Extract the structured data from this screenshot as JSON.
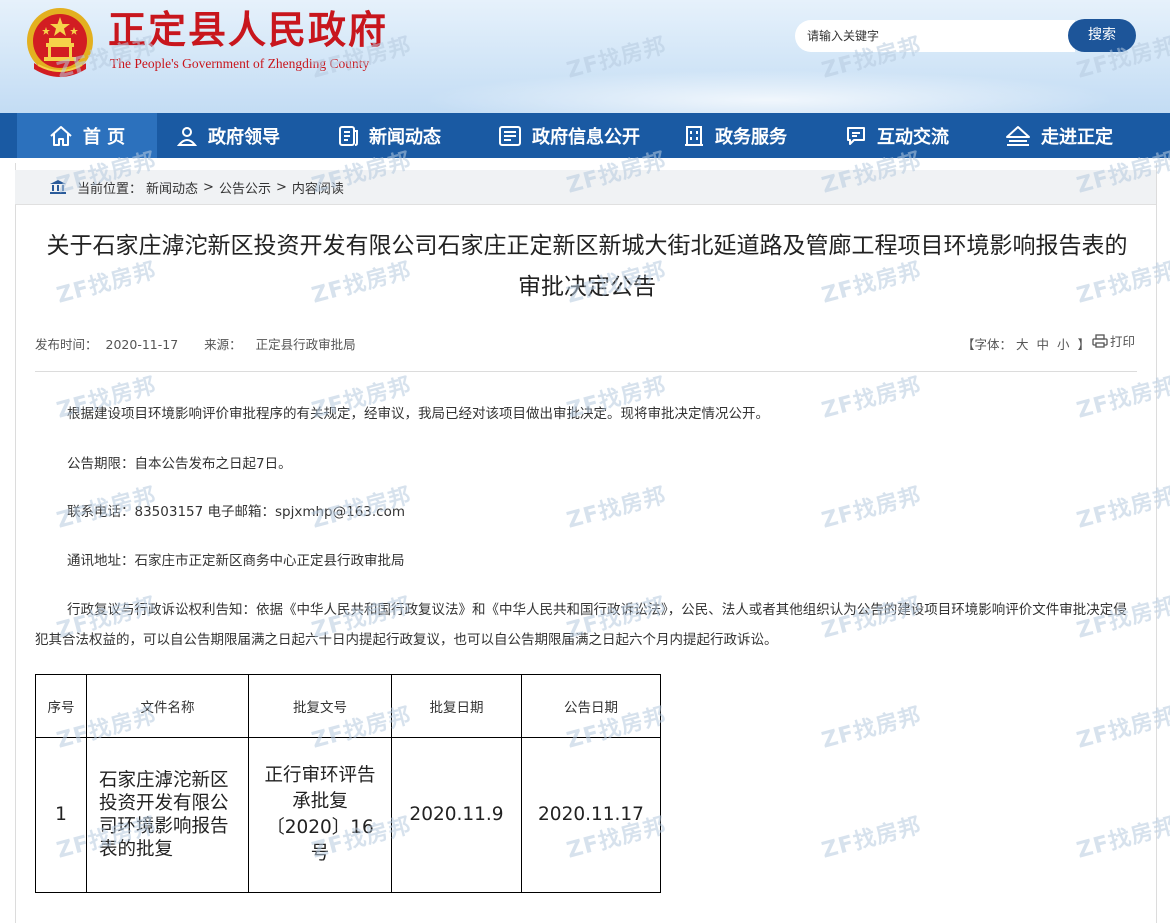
{
  "header": {
    "title_cn": "正定县人民政府",
    "title_en": "The People's Government of Zhengding County",
    "search_placeholder": "请输入关键字",
    "search_button": "搜索"
  },
  "nav": [
    {
      "label": "首 页",
      "icon": "home-icon"
    },
    {
      "label": "政府领导",
      "icon": "leader-icon"
    },
    {
      "label": "新闻动态",
      "icon": "news-icon"
    },
    {
      "label": "政府信息公开",
      "icon": "info-icon"
    },
    {
      "label": "政务服务",
      "icon": "building-icon"
    },
    {
      "label": "互动交流",
      "icon": "chat-icon"
    },
    {
      "label": "走进正定",
      "icon": "landmark-icon"
    }
  ],
  "breadcrumb": {
    "prefix": "当前位置：",
    "items": [
      "新闻动态",
      "公告公示",
      "内容阅读"
    ],
    "separator": ">"
  },
  "article": {
    "title": "关于石家庄滹沱新区投资开发有限公司石家庄正定新区新城大街北延道路及管廊工程项目环境影响报告表的审批决定公告",
    "publish_label": "发布时间：",
    "publish_date": "2020-11-17",
    "source_label": "来源：",
    "source": "正定县行政审批局",
    "font_label_open": "【字体：",
    "font_large": "大",
    "font_medium": "中",
    "font_small": "小",
    "font_label_close": "】",
    "print_label": "打印",
    "paragraphs": [
      "根据建设项目环境影响评价审批程序的有关规定，经审议，我局已经对该项目做出审批决定。现将审批决定情况公开。",
      "公告期限：自本公告发布之日起7日。",
      "联系电话：83503157 电子邮箱：spjxmhp@163.com",
      "通讯地址：石家庄市正定新区商务中心正定县行政审批局",
      "行政复议与行政诉讼权利告知：依据《中华人民共和国行政复议法》和《中华人民共和国行政诉讼法》，公民、法人或者其他组织认为公告的建设项目环境影响评价文件审批决定侵犯其合法权益的，可以自公告期限届满之日起六十日内提起行政复议，也可以自公告期限届满之日起六个月内提起行政诉讼。"
    ]
  },
  "table": {
    "headers": [
      "序号",
      "文件名称",
      "批复文号",
      "批复日期",
      "公告日期"
    ],
    "rows": [
      {
        "no": "1",
        "name": "石家庄滹沱新区投资开发有限公司环境影响报告表的批复",
        "doc_no": "正行审环评告承批复〔2020〕16号",
        "approve_date": "2020.11.9",
        "publish_date": "2020.11.17"
      }
    ]
  },
  "watermark": "ZF找房邦",
  "colors": {
    "brand_red": "#c8161d",
    "nav_blue": "#1a5aa3",
    "nav_active": "#2c71bd",
    "search_btn": "#1d5599"
  }
}
